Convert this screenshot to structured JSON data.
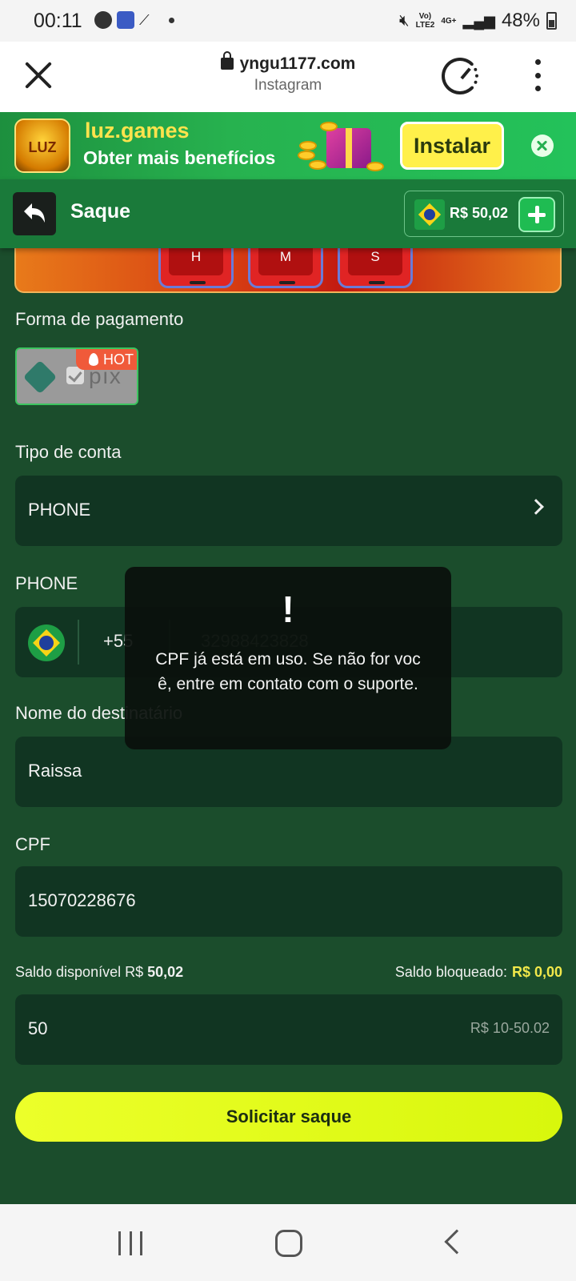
{
  "status_bar": {
    "time": "00:11",
    "network_label_top": "Vo)",
    "network_label_bottom": "LTE2",
    "network_type": "4G+",
    "battery": "48%"
  },
  "browser": {
    "url": "yngu1177.com",
    "source": "Instagram"
  },
  "promo": {
    "title": "luz.games",
    "subtitle": "Obter mais benefícios",
    "install_label": "Instalar",
    "logo_text": "LUZ"
  },
  "header": {
    "title": "Saque",
    "balance": "R$ 50,02"
  },
  "timer_tiles": [
    "H",
    "M",
    "S"
  ],
  "payment": {
    "label": "Forma de pagamento",
    "method_text": "pix",
    "hot_badge": "HOT"
  },
  "account_type": {
    "label": "Tipo de conta",
    "value": "PHONE"
  },
  "phone": {
    "label": "PHONE",
    "country_code": "+55",
    "number": "32988423828"
  },
  "recipient": {
    "label": "Nome do destinatário",
    "value": "Raissa"
  },
  "cpf": {
    "label": "CPF",
    "value": "15070228676"
  },
  "balance_info": {
    "available_label": "Saldo disponível R$",
    "available_value": "50,02",
    "blocked_label": "Saldo bloqueado:",
    "blocked_value": "R$ 0,00"
  },
  "amount": {
    "value": "50",
    "range": "R$ 10-50.02"
  },
  "submit_label": "Solicitar saque",
  "toast": {
    "icon": "!",
    "message": "CPF já está em uso. Se não for você, entre em contato com o suporte."
  },
  "colors": {
    "background": "#1b4d2c",
    "header": "#1a7a3a",
    "field": "#113522",
    "accent_yellow": "#f2e84a",
    "submit": "#e4fb1c"
  }
}
